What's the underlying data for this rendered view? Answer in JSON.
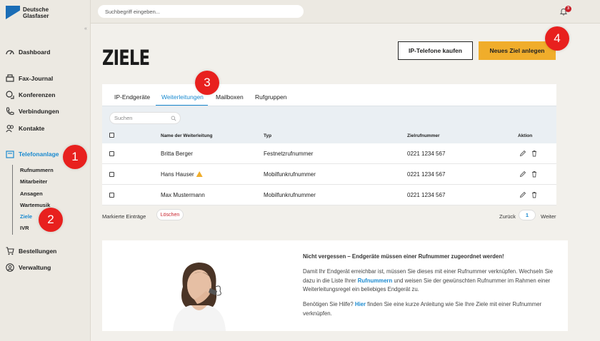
{
  "brand": {
    "name_line1": "Deutsche",
    "name_line2": "Glasfaser",
    "accent": "#1a6db6"
  },
  "topbar": {
    "search_placeholder": "Suchbegriff eingeben...",
    "notification_count": "3"
  },
  "sidebar": {
    "items": [
      {
        "label": "Dashboard",
        "icon": "dashboard-icon"
      },
      {
        "label": "Fax-Journal",
        "icon": "fax-icon"
      },
      {
        "label": "Konferenzen",
        "icon": "conference-icon"
      },
      {
        "label": "Verbindungen",
        "icon": "phone-icon"
      },
      {
        "label": "Kontakte",
        "icon": "contacts-icon"
      },
      {
        "label": "Telefonanlage",
        "icon": "phone-system-icon",
        "active": true
      },
      {
        "label": "Bestellungen",
        "icon": "cart-icon"
      },
      {
        "label": "Verwaltung",
        "icon": "user-circle-icon"
      }
    ],
    "subitems": [
      "Rufnummern",
      "Mitarbeiter",
      "Ansagen",
      "Wartemusik",
      "Ziele",
      "IVR"
    ],
    "active_subitem": "Ziele"
  },
  "main": {
    "title": "ZIELE",
    "btn_buy": "IP-Telefone kaufen",
    "btn_new": "Neues Ziel anlegen",
    "tabs": [
      "IP-Endgeräte",
      "Weiterleitungen",
      "Mailboxen",
      "Rufgruppen"
    ],
    "active_tab": "Weiterleitungen",
    "table_search_placeholder": "Suchen",
    "columns": [
      "Name der Weiterleitung",
      "Typ",
      "Zielrufnummer",
      "Aktion"
    ],
    "rows": [
      {
        "name": "Britta Berger",
        "type": "Festnetzrufnummer",
        "number": "0221 1234 567",
        "warning": false
      },
      {
        "name": "Hans Hauser",
        "type": "Mobilfunkrufnummer",
        "number": "0221 1234 567",
        "warning": true
      },
      {
        "name": "Max Mustermann",
        "type": "Mobilfunkrufnummer",
        "number": "0221 1234 567",
        "warning": false
      }
    ],
    "marked_label": "Markierte Einträge",
    "delete_label": "Löschen",
    "pager": {
      "prev": "Zurück",
      "page": "1",
      "next": "Weiter"
    }
  },
  "info": {
    "title": "Nicht vergessen – Endgeräte müssen einer Rufnummer zugeordnet werden!",
    "p1_a": "Damit Ihr Endgerät erreichbar ist, müssen Sie dieses mit einer Rufnummer verknüpfen. Wechseln Sie dazu in die Liste Ihrer ",
    "p1_link": "Rufnummern",
    "p1_b": " und weisen Sie der gewünschten Rufnummer im Rahmen einer Weiterleitungsregel ein beliebiges Endgerät zu.",
    "p2_a": "Benötigen Sie Hilfe? ",
    "p2_link": "Hier",
    "p2_b": " finden Sie eine kurze Anleitung wie Sie Ihre Ziele mit einer Rufnummer verknüpfen."
  },
  "markers": [
    "1",
    "2",
    "3",
    "4"
  ],
  "colors": {
    "active_blue": "#1a8ad0",
    "primary_button": "#f0ad2b",
    "marker_red": "#e8201e"
  }
}
